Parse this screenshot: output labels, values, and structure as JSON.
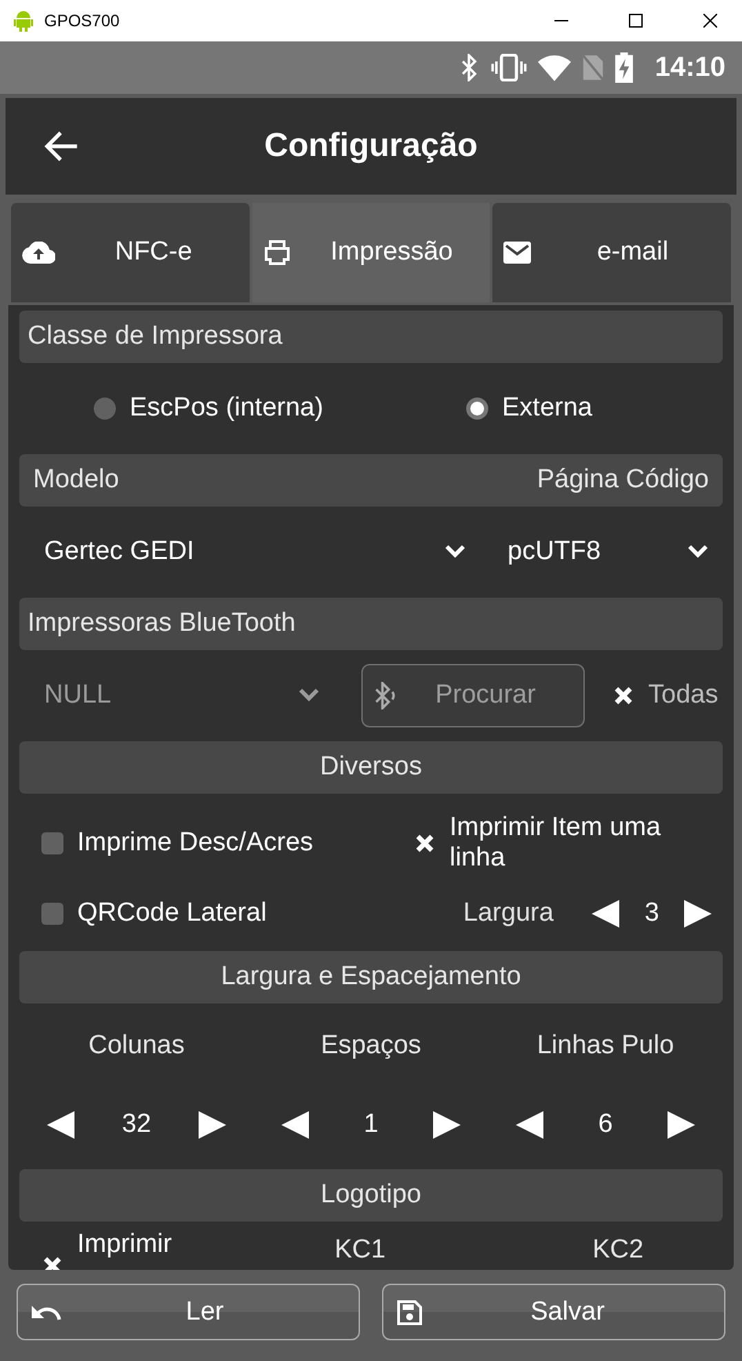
{
  "window": {
    "title": "GPOS700"
  },
  "status_bar": {
    "time": "14:10"
  },
  "app_bar": {
    "title": "Configuração"
  },
  "tabs": [
    {
      "label": "NFC-e",
      "selected": false
    },
    {
      "label": "Impressão",
      "selected": true
    },
    {
      "label": "e-mail",
      "selected": false
    }
  ],
  "printer_class": {
    "header": "Classe de Impressora",
    "options": [
      {
        "label": "EscPos (interna)",
        "selected": false
      },
      {
        "label": "Externa",
        "selected": true
      }
    ]
  },
  "model": {
    "header": "Modelo",
    "code_page_header": "Página Código",
    "model_value": "Gertec GEDI",
    "code_page_value": "pcUTF8"
  },
  "bluetooth": {
    "header": "Impressoras BlueTooth",
    "printer_value": "NULL",
    "search_button": "Procurar",
    "all": {
      "label": "Todas",
      "checked": true
    }
  },
  "misc": {
    "header": "Diversos",
    "options": [
      {
        "label": "Imprime Desc/Acres",
        "checked": false
      },
      {
        "label": "Imprimir Item uma linha",
        "checked": true
      },
      {
        "label": "QRCode Lateral",
        "checked": false
      }
    ],
    "width": {
      "label": "Largura",
      "value": "3"
    }
  },
  "spacing": {
    "header": "Largura e Espacejamento",
    "steppers": [
      {
        "label": "Colunas",
        "value": "32"
      },
      {
        "label": "Espaços",
        "value": "1"
      },
      {
        "label": "Linhas Pulo",
        "value": "6"
      }
    ]
  },
  "logo": {
    "header": "Logotipo",
    "print": {
      "label": "Imprimir",
      "checked": true
    },
    "kc1": "KC1",
    "kc2": "KC2"
  },
  "buttons": [
    {
      "label": "Ler"
    },
    {
      "label": "Salvar"
    }
  ]
}
